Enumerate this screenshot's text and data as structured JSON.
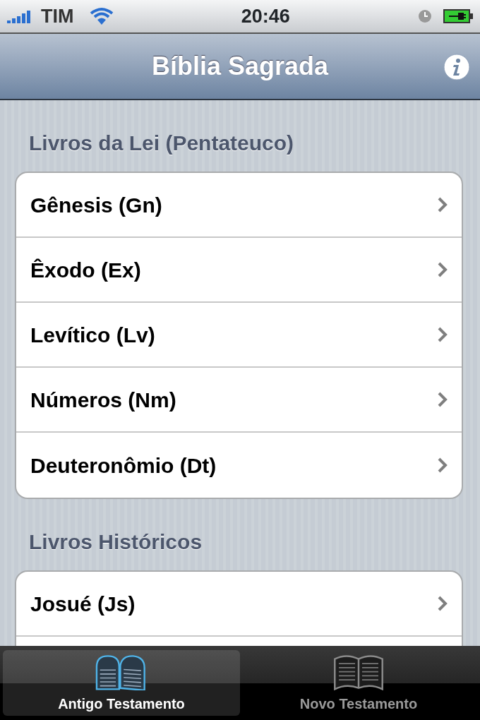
{
  "status_bar": {
    "carrier": "TIM",
    "time": "20:46"
  },
  "nav_bar": {
    "title": "Bíblia Sagrada"
  },
  "sections": [
    {
      "header": "Livros da Lei (Pentateuco)",
      "rows": [
        {
          "label": "Gênesis (Gn)"
        },
        {
          "label": "Êxodo (Ex)"
        },
        {
          "label": "Levítico (Lv)"
        },
        {
          "label": "Números (Nm)"
        },
        {
          "label": "Deuteronômio (Dt)"
        }
      ]
    },
    {
      "header": "Livros Históricos",
      "rows": [
        {
          "label": "Josué (Js)"
        }
      ]
    }
  ],
  "tab_bar": [
    {
      "label": "Antigo Testamento",
      "kind": "tablets",
      "selected": true
    },
    {
      "label": "Novo Testamento",
      "kind": "book",
      "selected": false
    }
  ]
}
